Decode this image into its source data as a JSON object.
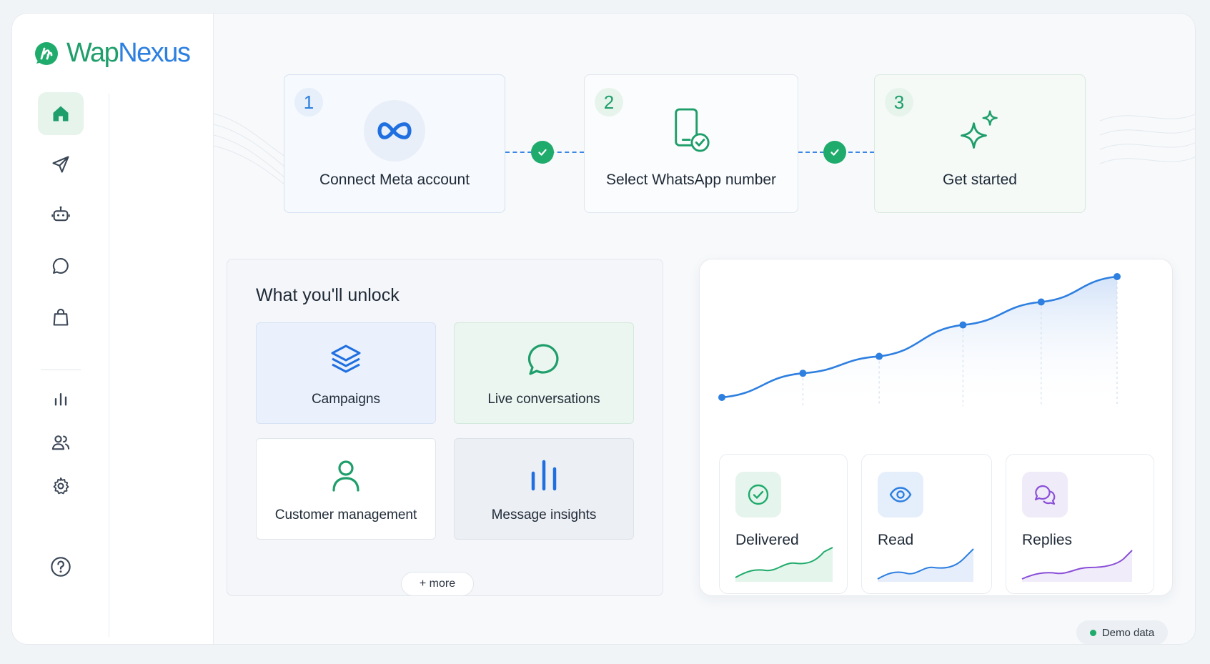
{
  "app": {
    "brand_name": "WapNexus",
    "brand_part1": "Wap",
    "brand_part2": "Nexus"
  },
  "sidebar": {
    "items": [
      {
        "icon": "home-icon",
        "active": true
      },
      {
        "icon": "send-icon"
      },
      {
        "icon": "bot-icon"
      },
      {
        "icon": "chat-icon"
      },
      {
        "icon": "shopping-bag-icon"
      },
      {
        "icon": "bar-chart-icon"
      },
      {
        "icon": "users-icon"
      },
      {
        "icon": "settings-icon"
      },
      {
        "icon": "help-icon"
      }
    ]
  },
  "steps": [
    {
      "number": "1",
      "label": "Connect Meta account",
      "icon": "meta-infinity-icon"
    },
    {
      "number": "2",
      "label": "Select WhatsApp number",
      "icon": "phone-check-icon"
    },
    {
      "number": "3",
      "label": "Get started",
      "icon": "sparkle-icon"
    }
  ],
  "unlock": {
    "title": "What you'll unlock",
    "features": [
      {
        "label": "Campaigns",
        "icon": "layers-icon"
      },
      {
        "label": "Live conversations",
        "icon": "chat-bubble-icon"
      },
      {
        "label": "Customer management",
        "icon": "user-icon"
      },
      {
        "label": "Message insights",
        "icon": "bars-icon"
      }
    ],
    "more_label": "+ more"
  },
  "analytics": {
    "metrics": [
      {
        "label": "Delivered",
        "icon": "check-circle-icon",
        "color": "#1fab6b"
      },
      {
        "label": "Read",
        "icon": "eye-icon",
        "color": "#2d7fe0"
      },
      {
        "label": "Replies",
        "icon": "replies-icon",
        "color": "#8a4fd8"
      }
    ]
  },
  "chart_data": {
    "type": "area",
    "x": [
      1,
      2,
      3,
      4,
      5,
      6
    ],
    "series": [
      {
        "values": [
          0,
          20,
          34,
          60,
          79,
          100
        ]
      }
    ],
    "title": "",
    "xlabel": "",
    "ylabel": "",
    "grid": false,
    "color": "#2d7fe0"
  },
  "footer": {
    "demo_label": "Demo data",
    "demo_dot_color": "#1fab6b"
  }
}
